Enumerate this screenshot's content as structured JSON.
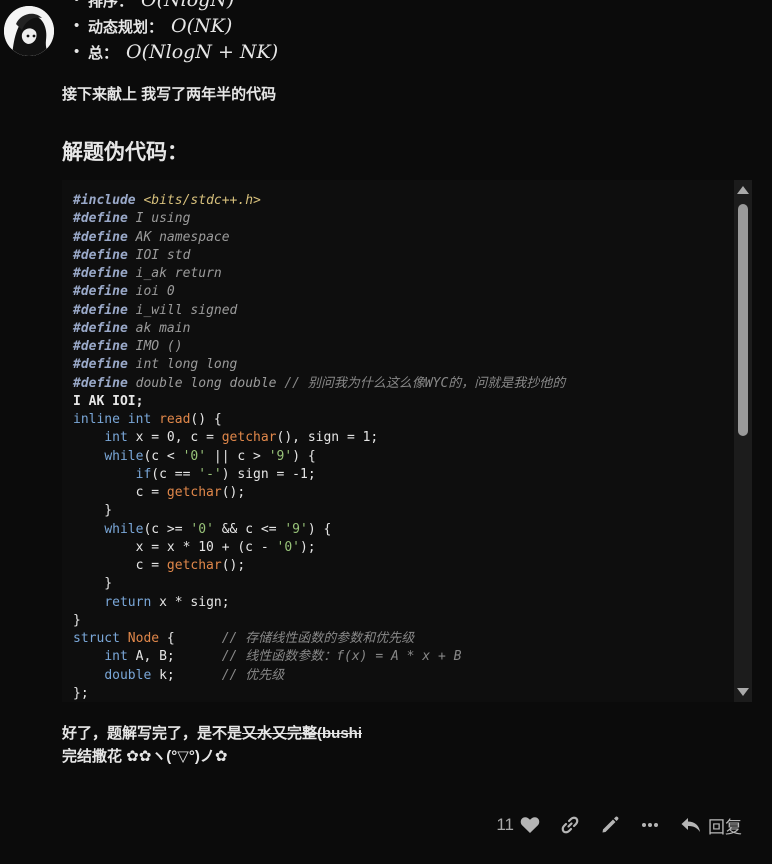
{
  "bullets": [
    {
      "label": "排序：",
      "math": "O(NlogN)"
    },
    {
      "label": "动态规划：",
      "math": "O(NK)"
    },
    {
      "label": "总：",
      "math": "O(NlogN + NK)"
    }
  ],
  "intro_text": "接下来献上 我写了两年半的代码",
  "section_heading": "解题伪代码：",
  "code_lines": [
    "#include <bits/stdc++.h>",
    "#define I using",
    "#define AK namespace",
    "#define IOI std",
    "#define i_ak return",
    "#define ioi 0",
    "#define i_will signed",
    "#define ak main",
    "#define IMO ()",
    "#define int long long",
    "#define double long double // 别问我为什么这么像WYC的，问就是我抄他的",
    "I AK IOI;",
    "inline int read() {",
    "    int x = 0, c = getchar(), sign = 1;",
    "    while(c < '0' || c > '9') {",
    "        if(c == '-') sign = -1;",
    "        c = getchar();",
    "    }",
    "    while(c >= '0' && c <= '9') {",
    "        x = x * 10 + (c - '0');",
    "        c = getchar();",
    "    }",
    "    return x * sign;",
    "}",
    "struct Node {      // 存储线性函数的参数和优先级",
    "    int A, B;      // 线性函数参数：f(x) = A * x + B",
    "    double k;      // 优先级",
    "};"
  ],
  "closing_text_plain": "好了，题解写完了，是不是",
  "closing_text_struck": "又水又完整(bushi",
  "celebrate_text": "完结撒花 ✿✿ヽ(°▽°)ノ✿",
  "actions": {
    "like_count": "11",
    "reply_label": "回复"
  },
  "colors": {
    "background": "#0b0b0b",
    "code_background": "#0e0e0e",
    "keyword": "#7aa7d8",
    "function": "#e0874a",
    "string": "#98c379",
    "comment": "#888888"
  }
}
